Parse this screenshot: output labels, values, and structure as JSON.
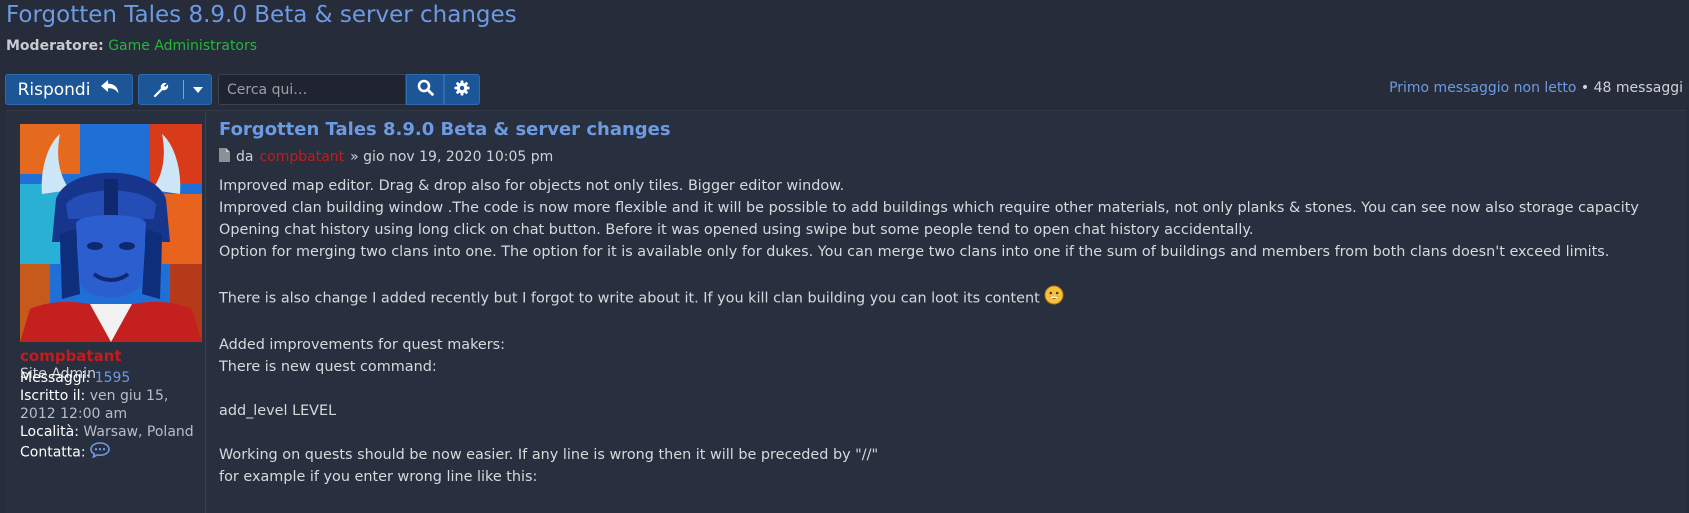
{
  "topic": {
    "title": "Forgotten Tales 8.9.0 Beta & server changes",
    "moderators_label": "Moderatore:",
    "moderators_group": "Game Administrators"
  },
  "toolbar": {
    "reply_label": "Rispondi",
    "search_placeholder": "Cerca qui…",
    "first_unread_label": "Primo messaggio non letto",
    "separator": " • ",
    "post_count": "48 messaggi"
  },
  "post": {
    "title": "Forgotten Tales 8.9.0 Beta & server changes",
    "by_label": "da",
    "author": "compbatant",
    "date": "» gio nov 19, 2020 10:05 pm",
    "content_before_emoji": "Improved map editor. Drag & drop also for objects not only tiles. Bigger editor window.\nImproved clan building window .The code is now more flexible and it will be possible to add buildings which require other materials, not only planks & stones. You can see now also storage capacity\nOpening chat history using long click on chat button. Before it was opened using swipe but some people tend to open chat history accidentally.\nOption for merging two clans into one. The option for it is available only for dukes. You can merge two clans into one if the sum of buildings and members from both clans doesn't exceed limits.\n\nThere is also change I added recently but I forgot to write about it. If you kill clan building you can loot its content ",
    "content_after_emoji": "\n\nAdded improvements for quest makers:\nThere is new quest command:\n\nadd_level LEVEL\n\nWorking on quests should be now easier. If any line is wrong then it will be preceded by \"//\"\nfor example if you enter wrong line like this:"
  },
  "profile": {
    "username": "compbatant",
    "rank": "Site Admin",
    "posts_label": "Messaggi:",
    "posts_value": "1595",
    "joined_label": "Iscritto il:",
    "joined_value": "ven giu 15, 2012 12:00 am",
    "location_label": "Località:",
    "location_value": "Warsaw, Poland",
    "contact_label": "Contatta:"
  },
  "colors": {
    "link": "#6d9be3",
    "username": "#c31c1c",
    "moderator_group": "#25b63b",
    "button": "#1d5696",
    "background": "#262c39"
  },
  "icons": [
    "reply-icon",
    "wrench-icon",
    "caret-down-icon",
    "search-icon",
    "gear-icon",
    "post-file-icon",
    "emoji-icon",
    "chat-bubble-icon"
  ]
}
